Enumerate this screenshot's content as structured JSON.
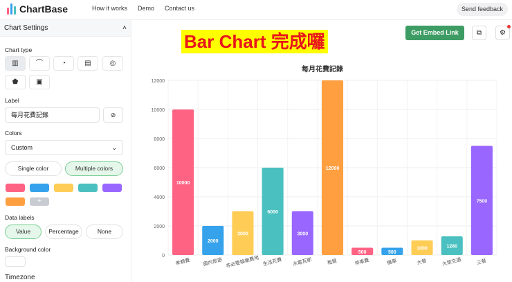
{
  "app": {
    "name": "ChartBase"
  },
  "nav": [
    "How it works",
    "Demo",
    "Contact us"
  ],
  "feedback": "Send feedback",
  "sidebar": {
    "title": "Chart Settings",
    "chart_type_label": "Chart type",
    "label_heading": "Label",
    "label_value": "每月花費記錄",
    "colors_heading": "Colors",
    "colors_value": "Custom",
    "single_color": "Single color",
    "multiple_colors": "Multiple colors",
    "swatches": [
      "#ff6384",
      "#36a2eb",
      "#ffcd56",
      "#4bc0c0",
      "#9966ff",
      "#ff9f40"
    ],
    "add_color": "+",
    "data_labels_heading": "Data labels",
    "data_labels": [
      "Value",
      "Percentage",
      "None"
    ],
    "background_heading": "Background color",
    "timezone_heading": "Timezone"
  },
  "banner": "Bar Chart 完成囉",
  "embed_button": "Get Embed Link",
  "chart_data": {
    "type": "bar",
    "title": "每月花費記錄",
    "categories": [
      "孝親費",
      "國內旅遊",
      "非必要娛樂費用",
      "生活花費",
      "水電瓦斯",
      "租屋",
      "停車費",
      "機車",
      "大餐",
      "大眾交通",
      "三餐"
    ],
    "values": [
      10000,
      2000,
      3000,
      6000,
      3000,
      12000,
      500,
      500,
      1000,
      1280,
      7500
    ],
    "colors": [
      "#ff6384",
      "#36a2eb",
      "#ffcd56",
      "#4bc0c0",
      "#9966ff",
      "#ff9f40"
    ],
    "ylim": [
      0,
      12000
    ],
    "yticks": [
      0,
      2000,
      4000,
      6000,
      8000,
      10000,
      12000
    ],
    "grid": true,
    "xlabel": "",
    "ylabel": ""
  }
}
